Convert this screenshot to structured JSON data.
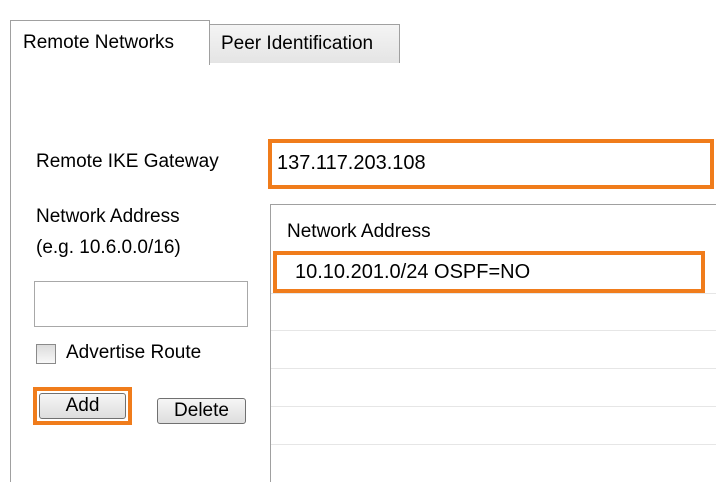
{
  "tabs": [
    {
      "label": "Remote Networks",
      "active": true
    },
    {
      "label": "Peer Identification",
      "active": false
    }
  ],
  "form": {
    "gateway_label": "Remote IKE Gateway",
    "gateway_value": "137.117.203.108",
    "network_label": "Network Address",
    "network_hint": "(e.g. 10.6.0.0/16)",
    "network_value": "",
    "advertise_label": "Advertise Route",
    "advertise_checked": false,
    "add_label": "Add",
    "delete_label": "Delete"
  },
  "network_list": {
    "header": "Network Address",
    "items": [
      "10.10.201.0/24 OSPF=NO"
    ]
  },
  "colors": {
    "highlight": "#f07c1b"
  }
}
